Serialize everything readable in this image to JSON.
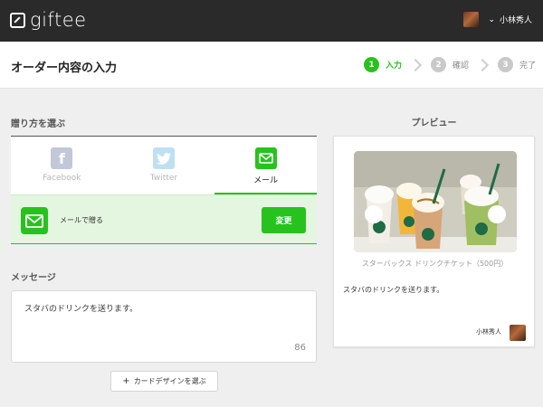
{
  "app": {
    "logo_text": "giftee"
  },
  "user": {
    "name": "小林秀人"
  },
  "header": {
    "title": "オーダー内容の入力",
    "steps": [
      {
        "num": "1",
        "label": "入力",
        "active": true
      },
      {
        "num": "2",
        "label": "確認",
        "active": false
      },
      {
        "num": "3",
        "label": "完了",
        "active": false
      }
    ]
  },
  "send_method": {
    "section_label": "贈り方を選ぶ",
    "tabs": [
      {
        "label": "Facebook",
        "icon": "facebook-icon"
      },
      {
        "label": "Twitter",
        "icon": "twitter-icon"
      },
      {
        "label": "メール",
        "icon": "mail-icon"
      }
    ],
    "selected_text": "メールで贈る",
    "change_button": "変更"
  },
  "message": {
    "section_label": "メッセージ",
    "text": "スタバのドリンクを送ります。",
    "char_count": "86"
  },
  "card_design": {
    "button_label": "カードデザインを選ぶ"
  },
  "preview": {
    "title": "プレビュー",
    "product_name": "スターバックス ドリンクチケット（500円）",
    "message": "スタバのドリンクを送ります。",
    "sender": "小林秀人"
  },
  "colors": {
    "accent": "#27c21e",
    "topbar": "#2a2a2a",
    "selected_bg": "#e4f5e0"
  }
}
